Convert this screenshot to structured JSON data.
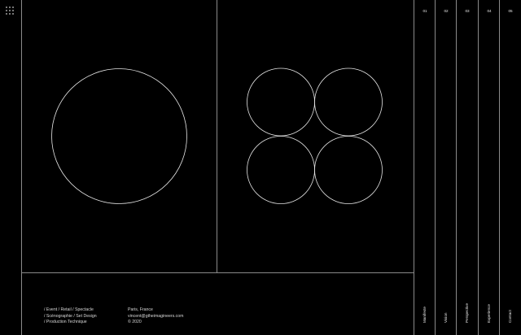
{
  "logo": {
    "icon": "grid-dots-icon"
  },
  "footer": {
    "services": [
      "/ Event / Retail / Spectacle",
      "/ Scénographie / Set Design",
      "/ Production Technique"
    ],
    "contact": [
      "Paris, France",
      "vincent@gtheimagineers.com",
      "© 2020"
    ]
  },
  "nav": [
    {
      "num": "01",
      "label": "Manifeste"
    },
    {
      "num": "02",
      "label": "Vision"
    },
    {
      "num": "03",
      "label": "Perspective"
    },
    {
      "num": "04",
      "label": "Experience"
    },
    {
      "num": "05",
      "label": "Contact"
    }
  ],
  "colors": {
    "background": "#000000",
    "line": "#8a8a8a",
    "text": "#ffffff"
  }
}
